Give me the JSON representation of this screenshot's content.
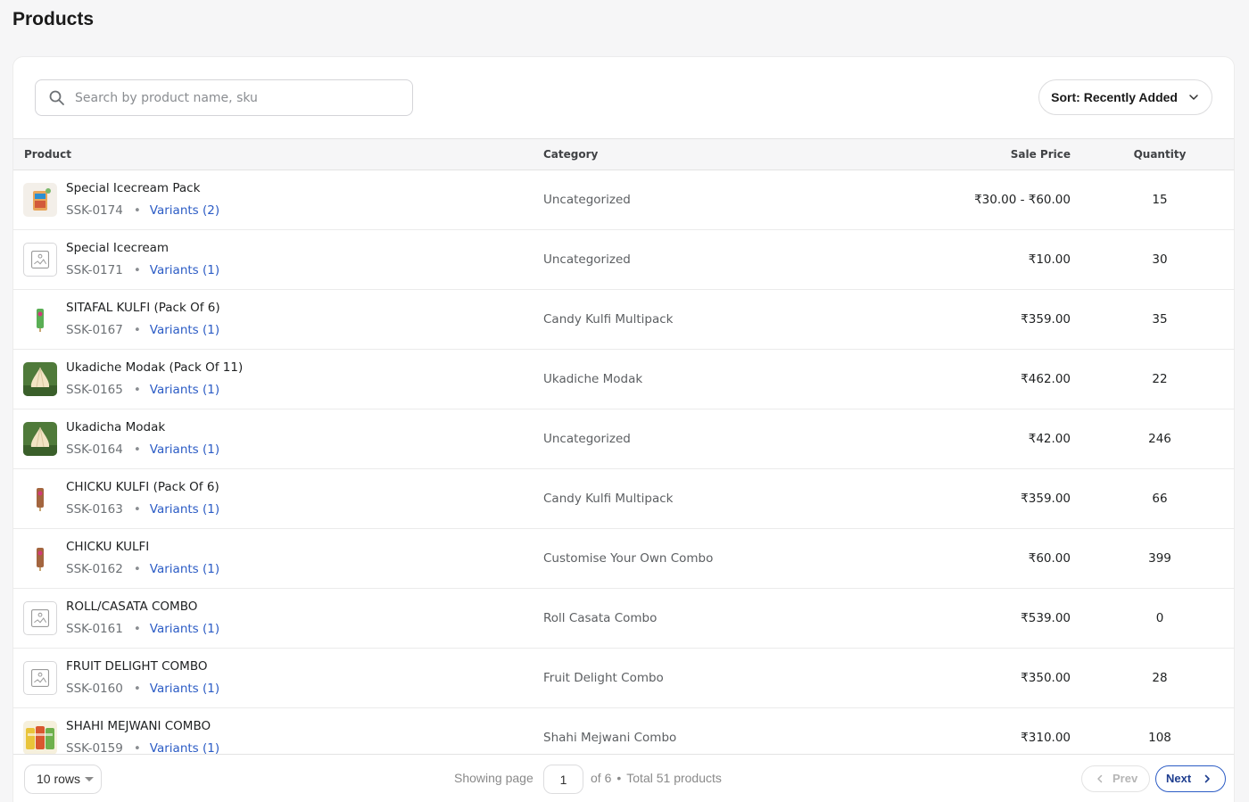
{
  "page": {
    "title": "Products"
  },
  "search": {
    "placeholder": "Search by product name, sku",
    "value": ""
  },
  "sort": {
    "label": "Sort: Recently Added"
  },
  "table": {
    "headers": {
      "product": "Product",
      "category": "Category",
      "sale_price": "Sale Price",
      "quantity": "Quantity"
    },
    "rows": [
      {
        "name": "Special Icecream Pack",
        "sku": "SSK-0174",
        "variants": "Variants (2)",
        "category": "Uncategorized",
        "price": "₹30.00 - ₹60.00",
        "quantity": "15",
        "thumb": "icecream-pack-image"
      },
      {
        "name": "Special Icecream",
        "sku": "SSK-0171",
        "variants": "Variants (1)",
        "category": "Uncategorized",
        "price": "₹10.00",
        "quantity": "30",
        "thumb": "image-placeholder-icon"
      },
      {
        "name": "SITAFAL KULFI (Pack Of 6)",
        "sku": "SSK-0167",
        "variants": "Variants (1)",
        "category": "Candy Kulfi Multipack",
        "price": "₹359.00",
        "quantity": "35",
        "thumb": "green-kulfi-image"
      },
      {
        "name": "Ukadiche Modak (Pack Of 11)",
        "sku": "SSK-0165",
        "variants": "Variants (1)",
        "category": "Ukadiche Modak",
        "price": "₹462.00",
        "quantity": "22",
        "thumb": "modak-image"
      },
      {
        "name": "Ukadicha Modak",
        "sku": "SSK-0164",
        "variants": "Variants (1)",
        "category": "Uncategorized",
        "price": "₹42.00",
        "quantity": "246",
        "thumb": "modak-image"
      },
      {
        "name": "CHICKU KULFI (Pack Of 6)",
        "sku": "SSK-0163",
        "variants": "Variants (1)",
        "category": "Candy Kulfi Multipack",
        "price": "₹359.00",
        "quantity": "66",
        "thumb": "brown-kulfi-image"
      },
      {
        "name": "CHICKU KULFI",
        "sku": "SSK-0162",
        "variants": "Variants (1)",
        "category": "Customise Your Own Combo",
        "price": "₹60.00",
        "quantity": "399",
        "thumb": "brown-kulfi-image"
      },
      {
        "name": "ROLL/CASATA COMBO",
        "sku": "SSK-0161",
        "variants": "Variants (1)",
        "category": "Roll Casata Combo",
        "price": "₹539.00",
        "quantity": "0",
        "thumb": "image-placeholder-icon"
      },
      {
        "name": "FRUIT DELIGHT COMBO",
        "sku": "SSK-0160",
        "variants": "Variants (1)",
        "category": "Fruit Delight Combo",
        "price": "₹350.00",
        "quantity": "28",
        "thumb": "image-placeholder-icon"
      },
      {
        "name": "SHAHI MEJWANI COMBO",
        "sku": "SSK-0159",
        "variants": "Variants (1)",
        "category": "Shahi Mejwani Combo",
        "price": "₹310.00",
        "quantity": "108",
        "thumb": "combo-image"
      }
    ]
  },
  "pagination": {
    "rows_per_page": "10 rows",
    "showing_label": "Showing page",
    "current_page": "1",
    "of_pages": "of 6",
    "total": "Total 51 products",
    "prev_label": "Prev",
    "next_label": "Next"
  },
  "colors": {
    "accent": "#2c5cc5",
    "background": "#f6f6f7"
  }
}
